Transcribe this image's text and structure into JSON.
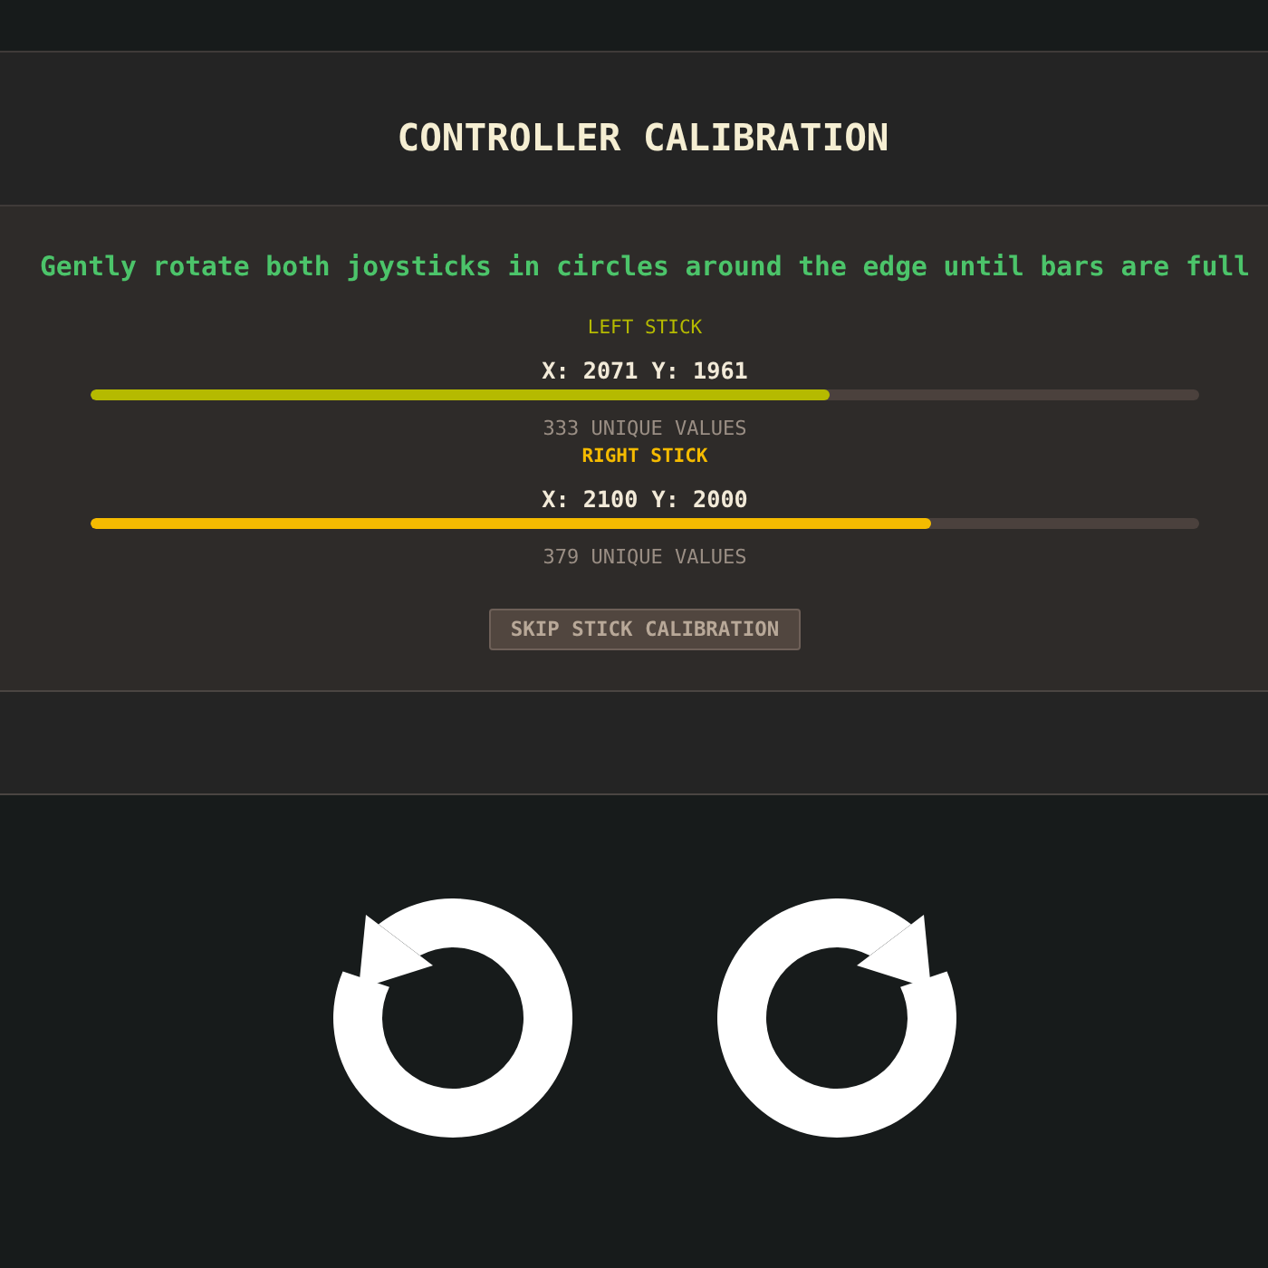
{
  "header": {
    "title": "CONTROLLER CALIBRATION"
  },
  "calibration": {
    "instruction": "Gently rotate both joysticks in circles around the edge until bars are full",
    "sticks": [
      {
        "label": "LEFT STICK",
        "color": "#b5ba00",
        "active": false,
        "reading": "X: 2071 Y: 1961",
        "level": 0.667,
        "count": "333 UNIQUE VALUES"
      },
      {
        "label": "RIGHT STICK",
        "color": "#f5bb00",
        "active": true,
        "reading": "X: 2100 Y: 2000",
        "level": 0.758,
        "count": "379 UNIQUE VALUES"
      }
    ],
    "skip_button": "SKIP STICK CALIBRATION"
  },
  "rotation_hints": [
    {
      "kind": "counterclockwise"
    },
    {
      "kind": "clockwise"
    }
  ]
}
